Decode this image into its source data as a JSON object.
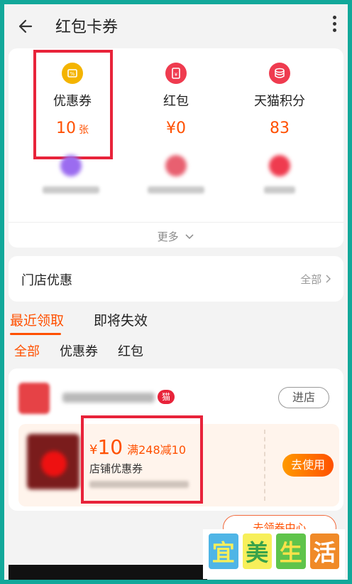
{
  "header": {
    "title": "红包卡券"
  },
  "assets": [
    {
      "label": "优惠券",
      "value": "10",
      "unit": "张",
      "icon": "coupon-icon",
      "color": "#f4b400"
    },
    {
      "label": "红包",
      "value": "¥0",
      "unit": "",
      "icon": "red-packet-icon",
      "color": "#ef3b4f"
    },
    {
      "label": "天猫积分",
      "value": "83",
      "unit": "",
      "icon": "points-coins-icon",
      "color": "#ef3b4f"
    }
  ],
  "more_label": "更多",
  "store_deals": {
    "title": "门店优惠",
    "all_label": "全部"
  },
  "tabs": [
    "最近领取",
    "即将失效"
  ],
  "subtabs": [
    "全部",
    "优惠券",
    "红包"
  ],
  "coupon": {
    "badge": "猫",
    "enter_label": "进店",
    "yen": "¥",
    "amount": "10",
    "condition": "满248减10",
    "type": "店铺优惠券",
    "use_label": "去使用"
  },
  "coupon_center_label": "去领券中心",
  "watermark": [
    "宜",
    "美",
    "生",
    "活"
  ],
  "colors": {
    "accent": "#ff5000",
    "highlight": "#e8233a",
    "frame": "#12a89a"
  }
}
